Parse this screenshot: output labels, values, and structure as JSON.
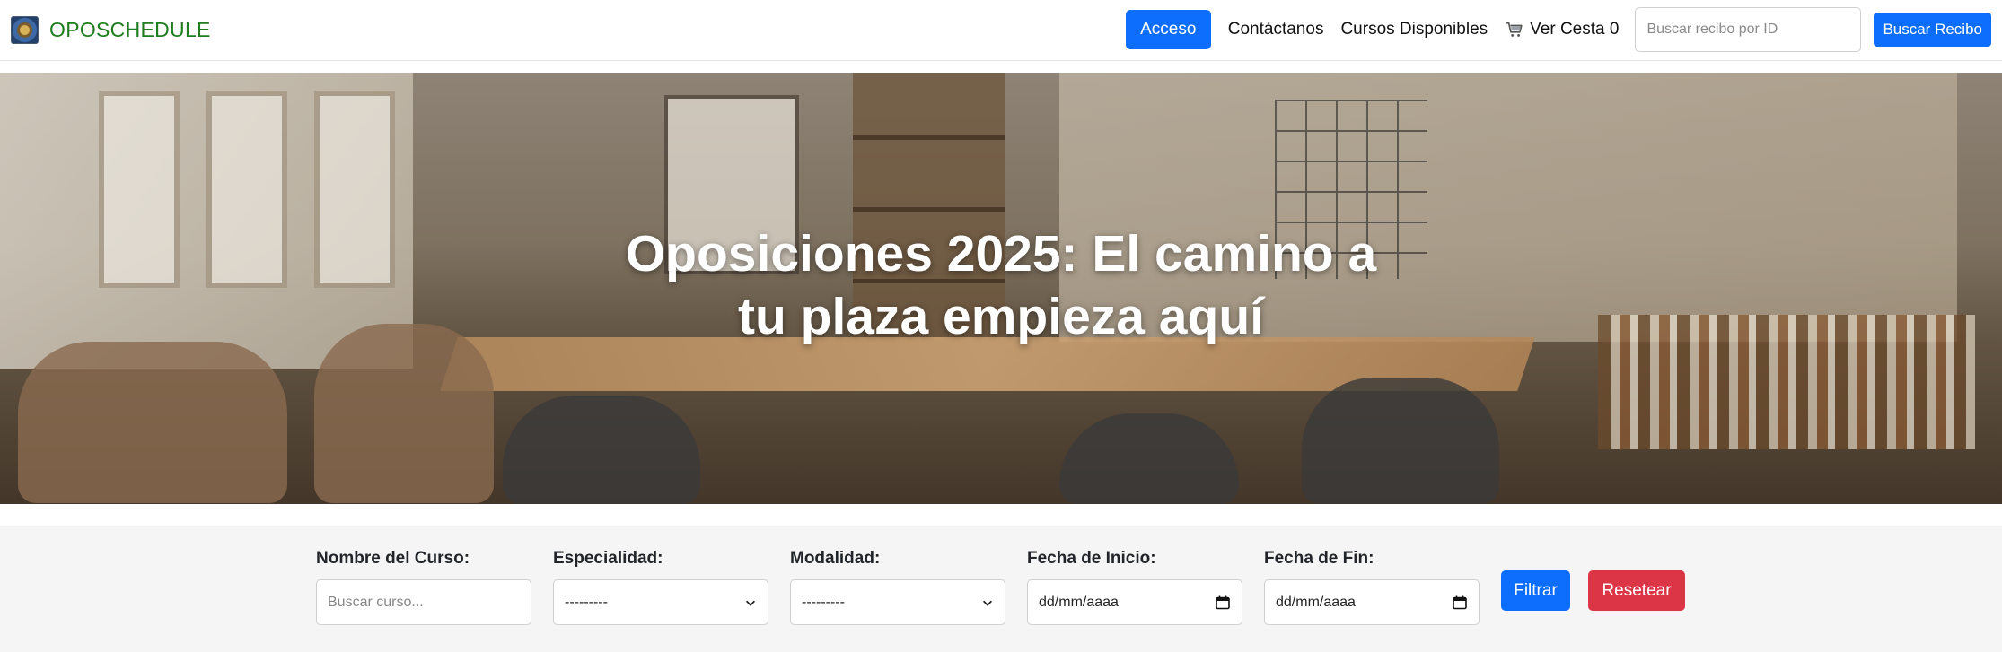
{
  "navbar": {
    "brand": "OPOSCHEDULE",
    "login_label": "Acceso",
    "contact_label": "Contáctanos",
    "courses_label": "Cursos Disponibles",
    "cart_label": "Ver Cesta",
    "cart_count": "0",
    "receipt_search_placeholder": "Buscar recibo por ID",
    "receipt_search_button": "Buscar Recibo"
  },
  "hero": {
    "title": "Oposiciones 2025: El camino a tu plaza empieza aquí"
  },
  "filters": {
    "course_name_label": "Nombre del Curso:",
    "course_name_placeholder": "Buscar curso...",
    "specialty_label": "Especialidad:",
    "specialty_value": "---------",
    "modality_label": "Modalidad:",
    "modality_value": "---------",
    "start_date_label": "Fecha de Inicio:",
    "start_date_value": "dd/mm/aaaa",
    "end_date_label": "Fecha de Fin:",
    "end_date_value": "dd/mm/aaaa",
    "filter_button": "Filtrar",
    "reset_button": "Resetear"
  },
  "colors": {
    "primary": "#0d6efd",
    "danger": "#dc3545",
    "brand_green": "#1f7d1f"
  },
  "icons": [
    "brand-logo-icon",
    "cart-icon",
    "chevron-down-icon",
    "calendar-icon"
  ]
}
